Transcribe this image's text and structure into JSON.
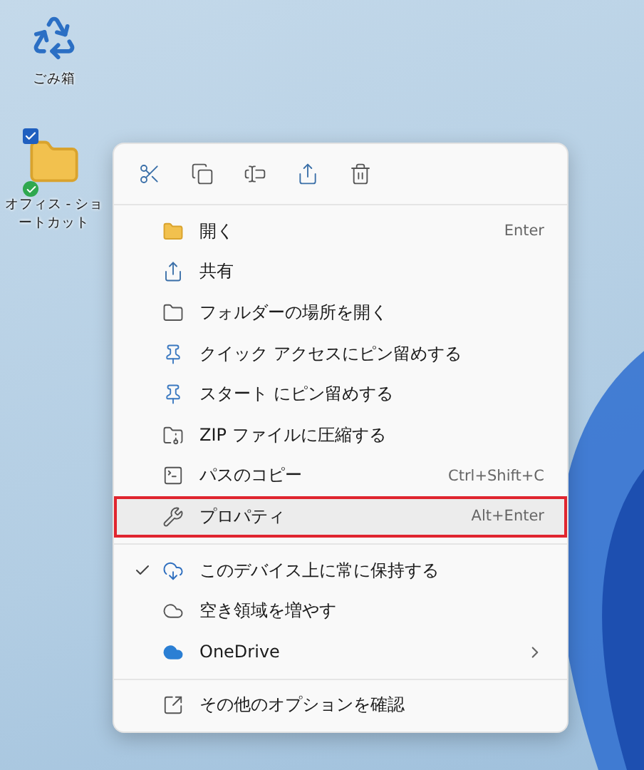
{
  "desktop_icons": [
    {
      "label": "ごみ箱",
      "checked": false
    },
    {
      "label": "オフィス - ショートカット",
      "checked": true
    }
  ],
  "context_menu": {
    "sections": [
      [
        {
          "label": "開く",
          "shortcut": "Enter",
          "checked": false,
          "selected": false,
          "submenu": false
        },
        {
          "label": "共有",
          "checked": false,
          "selected": false,
          "submenu": false
        },
        {
          "label": "フォルダーの場所を開く",
          "checked": false,
          "selected": false,
          "submenu": false
        },
        {
          "label": "クイック アクセスにピン留めする",
          "checked": false,
          "selected": false,
          "submenu": false
        },
        {
          "label": "スタート にピン留めする",
          "checked": false,
          "selected": false,
          "submenu": false
        },
        {
          "label": "ZIP ファイルに圧縮する",
          "checked": false,
          "selected": false,
          "submenu": false
        },
        {
          "label": "パスのコピー",
          "shortcut": "Ctrl+Shift+C",
          "checked": false,
          "selected": false,
          "submenu": false
        },
        {
          "label": "プロパティ",
          "shortcut": "Alt+Enter",
          "checked": false,
          "selected": true,
          "submenu": false
        }
      ],
      [
        {
          "label": "このデバイス上に常に保持する",
          "checked": true,
          "selected": false,
          "submenu": false
        },
        {
          "label": "空き領域を増やす",
          "checked": false,
          "selected": false,
          "submenu": false
        },
        {
          "label": "OneDrive",
          "checked": false,
          "selected": false,
          "submenu": true
        }
      ],
      [
        {
          "label": "その他のオプションを確認",
          "checked": false,
          "selected": false,
          "submenu": false
        }
      ]
    ]
  }
}
